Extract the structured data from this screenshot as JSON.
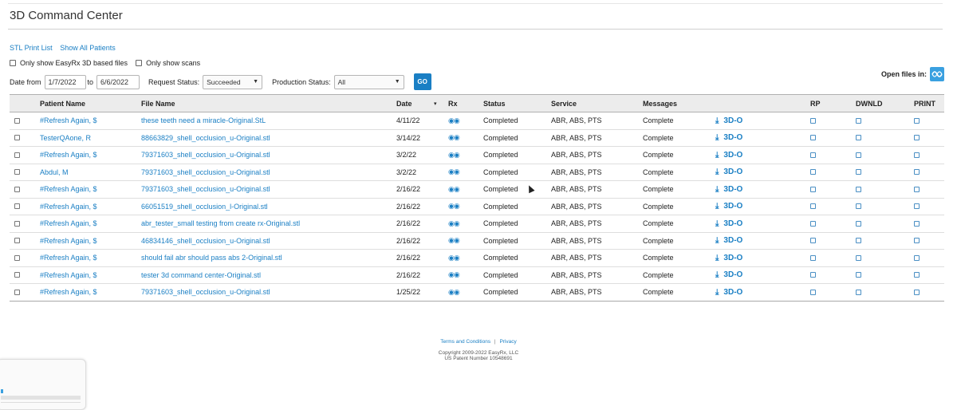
{
  "title": "3D Command Center",
  "links": [
    "STL Print List",
    "Show All Patients"
  ],
  "filters": {
    "only_3d_label": "Only show EasyRx 3D based files",
    "only_scans_label": "Only show scans",
    "date_from_label": "Date from",
    "date_from": "1/7/2022",
    "date_to_label": "to",
    "date_to": "6/6/2022",
    "request_status_label": "Request Status:",
    "request_status": "Succeeded",
    "production_status_label": "Production Status:",
    "production_status": "All",
    "go_label": "GO"
  },
  "open_files_label": "Open files in:",
  "table": {
    "columns": {
      "patient": "Patient Name",
      "file": "File Name",
      "date": "Date",
      "sort_icon": "▾",
      "rx": "Rx",
      "status": "Status",
      "service": "Service",
      "messages": "Messages",
      "rp": "RP",
      "download": "DWNLD",
      "print": "PRINT"
    },
    "rx_icon": "binoculars-icon",
    "download_icon": "download-icon",
    "view_label": "3D-O",
    "rows": [
      {
        "patient": "#Refresh Again, $",
        "file": "these teeth need a miracle-Original.StL",
        "date": "4/11/22",
        "status": "Completed",
        "service": "ABR, ABS, PTS",
        "messages": "Complete"
      },
      {
        "patient": "TesterQAone, R",
        "file": "88663829_shell_occlusion_u-Original.stl",
        "date": "3/14/22",
        "status": "Completed",
        "service": "ABR, ABS, PTS",
        "messages": "Complete"
      },
      {
        "patient": "#Refresh Again, $",
        "file": "79371603_shell_occlusion_u-Original.stl",
        "date": "3/2/22",
        "status": "Completed",
        "service": "ABR, ABS, PTS",
        "messages": "Complete"
      },
      {
        "patient": "Abdul, M",
        "file": "79371603_shell_occlusion_u-Original.stl",
        "date": "3/2/22",
        "status": "Completed",
        "service": "ABR, ABS, PTS",
        "messages": "Complete"
      },
      {
        "patient": "#Refresh Again, $",
        "file": "79371603_shell_occlusion_u-Original.stl",
        "date": "2/16/22",
        "status": "Completed",
        "service": "ABR, ABS, PTS",
        "messages": "Complete"
      },
      {
        "patient": "#Refresh Again, $",
        "file": "66051519_shell_occlusion_l-Original.stl",
        "date": "2/16/22",
        "status": "Completed",
        "service": "ABR, ABS, PTS",
        "messages": "Complete"
      },
      {
        "patient": "#Refresh Again, $",
        "file": "abr_tester_small testing from create rx-Original.stl",
        "date": "2/16/22",
        "status": "Completed",
        "service": "ABR, ABS, PTS",
        "messages": "Complete"
      },
      {
        "patient": "#Refresh Again, $",
        "file": "46834146_shell_occlusion_u-Original.stl",
        "date": "2/16/22",
        "status": "Completed",
        "service": "ABR, ABS, PTS",
        "messages": "Complete"
      },
      {
        "patient": "#Refresh Again, $",
        "file": "should fail abr should pass abs 2-Original.stl",
        "date": "2/16/22",
        "status": "Completed",
        "service": "ABR, ABS, PTS",
        "messages": "Complete"
      },
      {
        "patient": "#Refresh Again, $",
        "file": "tester 3d command center-Original.stl",
        "date": "2/16/22",
        "status": "Completed",
        "service": "ABR, ABS, PTS",
        "messages": "Complete"
      },
      {
        "patient": "#Refresh Again, $",
        "file": "79371603_shell_occlusion_u-Original.stl",
        "date": "1/25/22",
        "status": "Completed",
        "service": "ABR, ABS, PTS",
        "messages": "Complete"
      }
    ]
  },
  "footer": {
    "terms": "Terms and Conditions",
    "separator": "|",
    "privacy": "Privacy",
    "copyright": "Copyright 2009-2022 EasyRx, LLC",
    "patent": "US Patent Number 10548691"
  },
  "colors": {
    "accent": "#1a7fc4",
    "header_bg": "#ececec"
  }
}
